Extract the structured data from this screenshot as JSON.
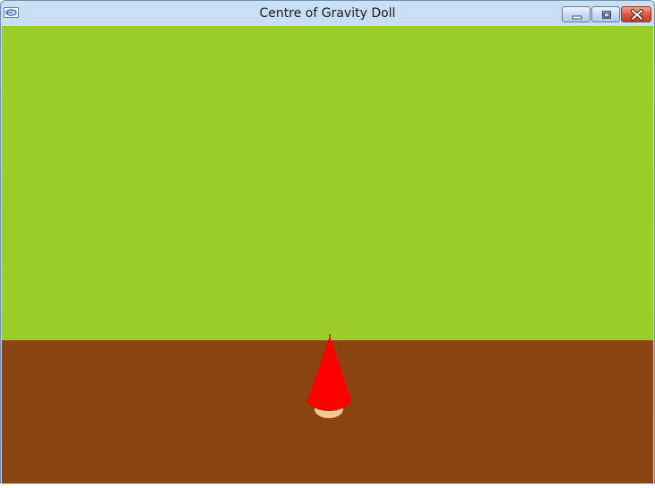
{
  "window": {
    "title": "Centre of Gravity Doll",
    "icon": "app-icon",
    "controls": {
      "minimize_icon": "minimize-icon",
      "maximize_icon": "maximize-icon",
      "close_icon": "close-icon"
    }
  },
  "scene": {
    "sky_color": "#9acd28",
    "ground_color": "#8b4513",
    "doll": {
      "hat_color": "#ff0000",
      "face_color": "#f5c894",
      "hair_color": "#8b4513"
    }
  }
}
